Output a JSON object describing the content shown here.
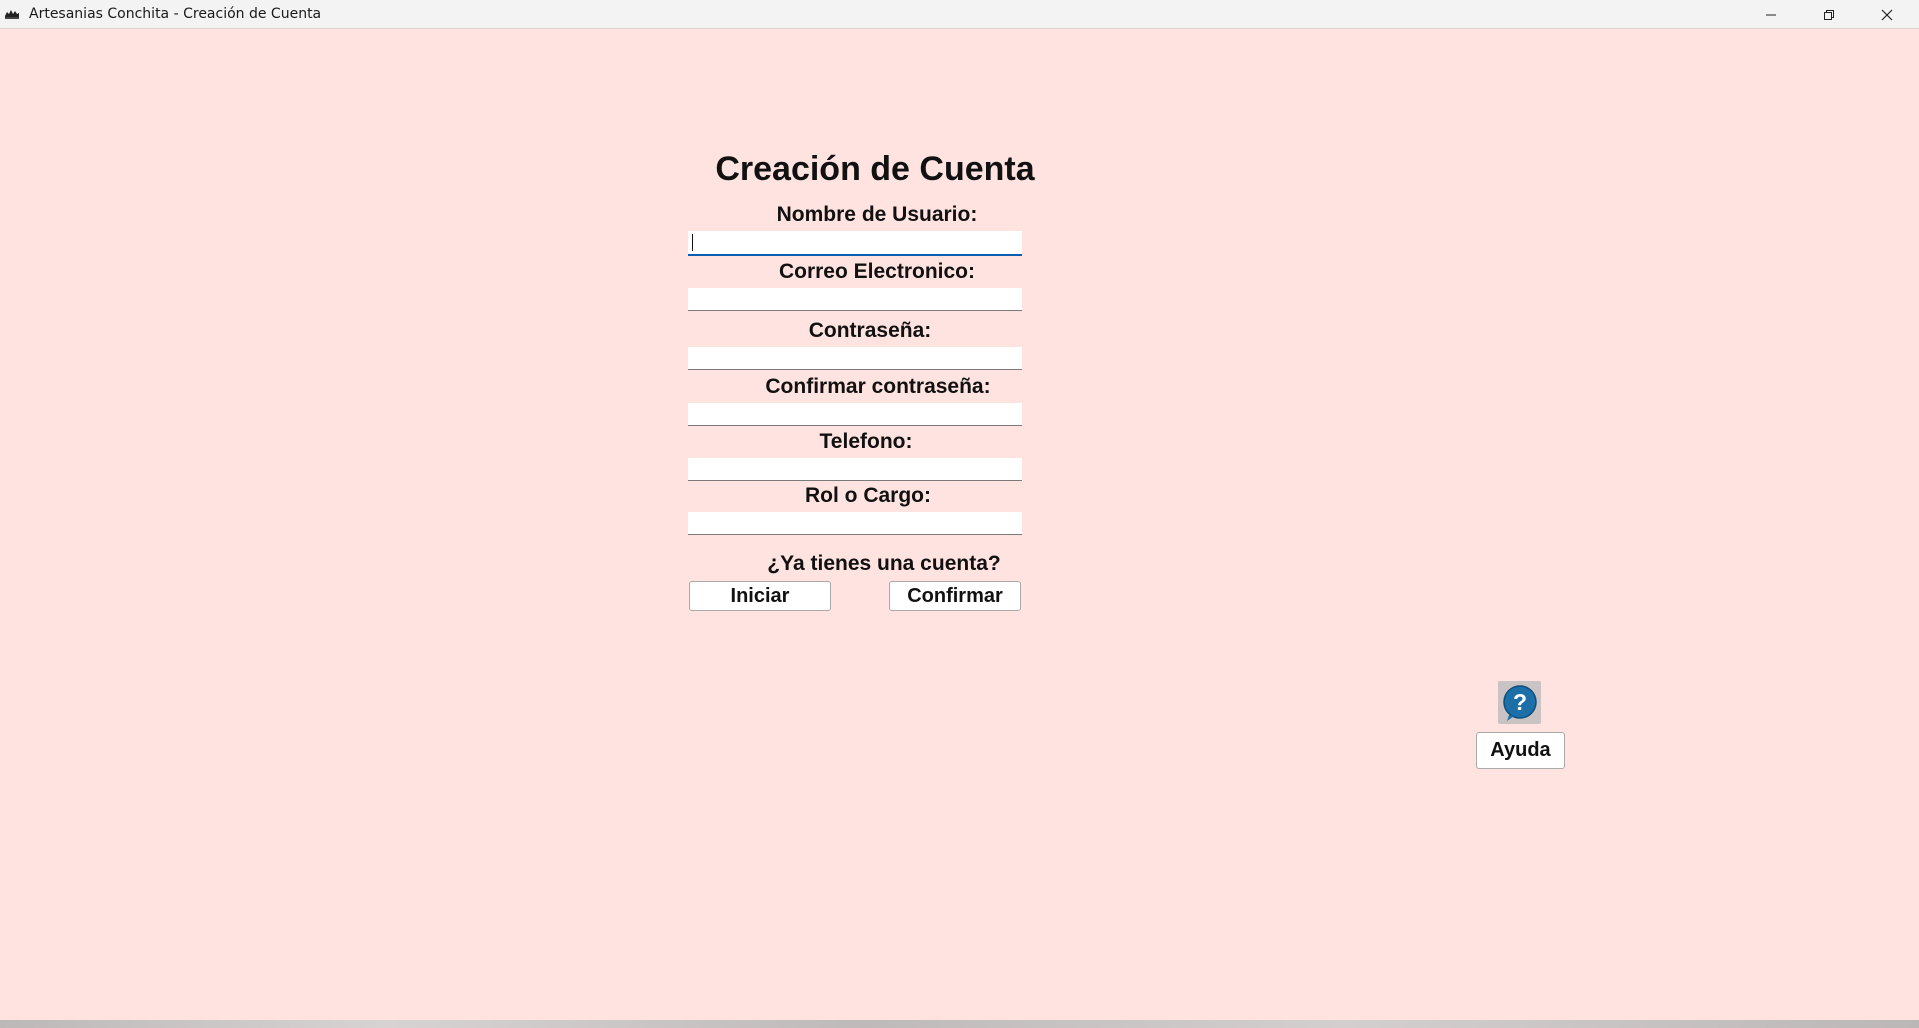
{
  "window": {
    "title": "Artesanias Conchita - Creación de Cuenta",
    "icon": "app-logo-icon",
    "controls": [
      "minimize-icon",
      "restore-icon",
      "close-icon"
    ]
  },
  "form": {
    "title": "Creación de Cuenta",
    "fields": [
      {
        "label": "Nombre de Usuario:",
        "value": "",
        "focused": true
      },
      {
        "label": "Correo Electronico:",
        "value": ""
      },
      {
        "label": "Contraseña:",
        "value": ""
      },
      {
        "label": "Confirmar contraseña:",
        "value": ""
      },
      {
        "label": "Telefono:",
        "value": ""
      },
      {
        "label": "Rol o Cargo:",
        "value": ""
      }
    ],
    "question": "¿Ya tienes una cuenta?",
    "login_button": "Iniciar",
    "confirm_button": "Confirmar"
  },
  "help": {
    "icon": "help-question-icon",
    "button": "Ayuda"
  },
  "colors": {
    "background": "#ffe3e0",
    "focus_accent": "#0a5fb4",
    "help_icon_blue": "#1d6fa8"
  }
}
